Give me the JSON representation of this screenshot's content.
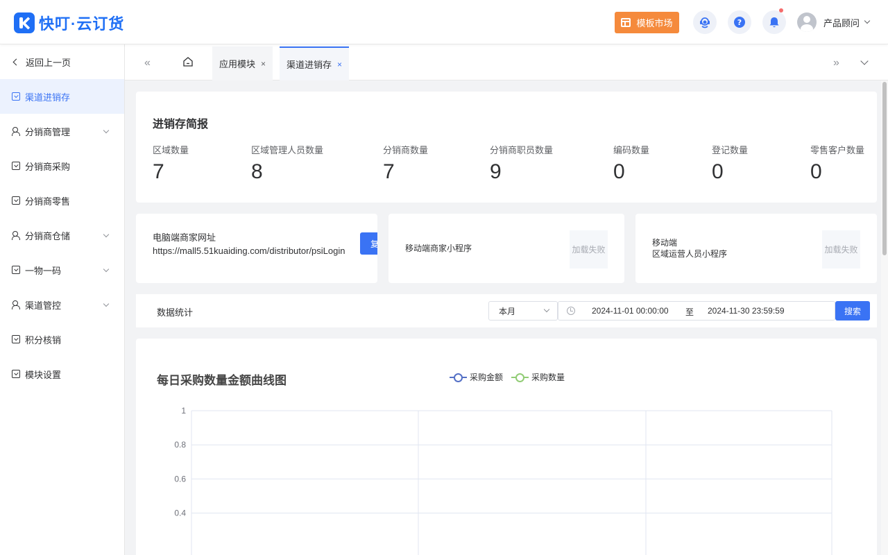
{
  "header": {
    "logo_text": "快叮·云订货",
    "template_market": "模板市场",
    "user_name": "产品顾问",
    "icons": [
      "customer-service-icon",
      "help-icon",
      "bell-icon"
    ],
    "notification_dot": true,
    "accent": "#3a73f4",
    "template_color": "#f58a3c"
  },
  "sidebar": {
    "back_label": "返回上一页",
    "items": [
      {
        "label": "渠道进销存",
        "icon": "box-icon",
        "active": true
      },
      {
        "label": "分销商管理",
        "icon": "people-icon",
        "expandable": true
      },
      {
        "label": "分销商采购",
        "icon": "box-icon"
      },
      {
        "label": "分销商零售",
        "icon": "box-icon"
      },
      {
        "label": "分销商仓储",
        "icon": "people-icon",
        "expandable": true
      },
      {
        "label": "一物一码",
        "icon": "box-icon",
        "expandable": true
      },
      {
        "label": "渠道管控",
        "icon": "people-icon",
        "expandable": true
      },
      {
        "label": "积分核销",
        "icon": "box-icon"
      },
      {
        "label": "模块设置",
        "icon": "box-icon"
      }
    ]
  },
  "tabs": {
    "items": [
      {
        "label": "应用模块",
        "active": false
      },
      {
        "label": "渠道进销存",
        "active": true
      }
    ],
    "prev_symbol": "«",
    "next_symbol": "»",
    "close_symbol": "×"
  },
  "summary": {
    "title": "进销存简报",
    "stats": [
      {
        "label": "区域数量",
        "value": "7"
      },
      {
        "label": "区域管理人员数量",
        "value": "8"
      },
      {
        "label": "分销商数量",
        "value": "7"
      },
      {
        "label": "分销商职员数量",
        "value": "9"
      },
      {
        "label": "编码数量",
        "value": "0"
      },
      {
        "label": "登记数量",
        "value": "0"
      },
      {
        "label": "零售客户数量",
        "value": "0"
      }
    ]
  },
  "links": {
    "pc_title": "电脑端商家网址",
    "pc_url": "https://mall5.51kuaiding.com/distributor/psiLogin",
    "copy_label": "复制",
    "mobile_merchant": "移动端商家小程序",
    "mobile_region_line1": "移动端",
    "mobile_region_line2": "区域运营人员小程序",
    "load_failed": "加载失败"
  },
  "stats_filter": {
    "label": "数据统计",
    "period": "本月",
    "start": "2024-11-01 00:00:00",
    "separator": "至",
    "end": "2024-11-30 23:59:59",
    "search_label": "搜索"
  },
  "chart_data": {
    "type": "line",
    "title": "每日采购数量金额曲线图",
    "series": [
      {
        "name": "采购金额",
        "values": [],
        "color": "#5470c6"
      },
      {
        "name": "采购数量",
        "values": [],
        "color": "#91cc75"
      }
    ],
    "y_ticks": [
      "1",
      "0.8",
      "0.6",
      "0.4"
    ],
    "ylim": [
      0,
      1
    ],
    "grid": true,
    "legend_position": "top-center"
  }
}
